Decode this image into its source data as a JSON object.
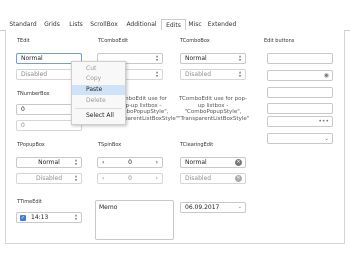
{
  "tabs": [
    "Standard",
    "Grids",
    "Lists",
    "ScrollBox",
    "Additional",
    "Edits",
    "Misc",
    "Extended"
  ],
  "active_tab": "Edits",
  "tedit": {
    "label": "TEdit",
    "normal": "Normal",
    "disabled": "Disabled"
  },
  "tcomboedit": {
    "label": "TComboEdit",
    "note": "TComboEdit use for pop-up listbox - \"ComboPopupStyle\", \"TransparentListBoxStyle\""
  },
  "tcombobox": {
    "label": "TComboBox",
    "normal": "Normal",
    "disabled": "Disabled",
    "note": "TComboEdit use for pop-up listbox - \"ComboPopupStyle\", \"TransparentListBoxStyle\""
  },
  "editbuttons": {
    "label": "Edit buttons"
  },
  "tnumberbox": {
    "label": "TNumberBox",
    "value1": "0",
    "value2": "0"
  },
  "context_menu": {
    "cut": "Cut",
    "copy": "Copy",
    "paste": "Paste",
    "delete": "Delete",
    "select_all": "Select All"
  },
  "tpopupbox": {
    "label": "TPopupBox",
    "normal": "Normal",
    "disabled": "Disabled"
  },
  "tspinbox": {
    "label": "TSpinBox",
    "value1": "0",
    "value2": "0"
  },
  "tclearingedit": {
    "label": "TClearingEdit",
    "normal": "Normal",
    "disabled": "Disabled"
  },
  "ttimeedit": {
    "label": "TTimeEdit",
    "value": "14:13"
  },
  "memo": {
    "text": "Memo"
  },
  "dateedit": {
    "value": "06.09.2017"
  }
}
